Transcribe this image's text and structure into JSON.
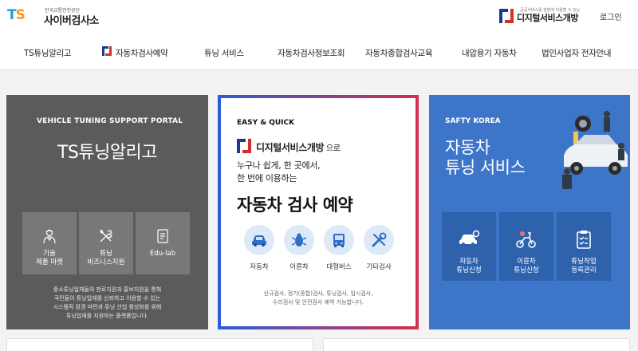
{
  "header": {
    "logo_mark_t": "T",
    "logo_mark_s": "S",
    "org_name": "한국교통안전공단",
    "site_title": "사이버검사소",
    "top_right_sub": "공공서비스를 한번에 이용할 수 있는",
    "digital_service": "디지털서비스개방",
    "login": "로그인"
  },
  "nav": {
    "items": [
      "TS튜닝알리고",
      "자동차검사예약",
      "튜닝 서비스",
      "자동차검사정보조회",
      "자동차종합검사교육",
      "내압용기 자동차",
      "법인사업자 전자안내"
    ]
  },
  "left_card": {
    "kicker": "VEHICLE TUNING SUPPORT PORTAL",
    "title": "TS튜닝알리고",
    "tiles": [
      {
        "label": "기술\n제품 마켓",
        "icon": "mechanic-icon"
      },
      {
        "label": "튜닝\n비즈니스지원",
        "icon": "tools-icon"
      },
      {
        "label": "Edu-lab",
        "icon": "document-icon"
      }
    ],
    "desc": "중소튜닝업체들의 판로지원과 홍보지원을 통해\n국민들이 튜닝업체를 신뢰하고 이용할 수 있는\n시스템적 환경 마련과 튜닝 산업 활성화를 위해\n튜닝업체를 지원하는 플랫폼입니다."
  },
  "mid_card": {
    "kicker": "EASY & QUICK",
    "brand": "디지털서비스개방",
    "brand_suffix": " 으로",
    "lines": "누구나 쉽게, 한 곳에서,\n한 번에 이용하는",
    "big": "자동차 검사 예약",
    "circles": [
      {
        "label": "자동차",
        "icon": "car-icon"
      },
      {
        "label": "이륜차",
        "icon": "bug-icon"
      },
      {
        "label": "대형버스",
        "icon": "bus-icon"
      },
      {
        "label": "기타검사",
        "icon": "wrench-icon"
      }
    ],
    "note": "신규검사, 정기(종합)검사, 튜닝검사, 임시검사,\n수리검사 및 안전검사 예약 가능합니다."
  },
  "right_card": {
    "kicker": "SAFTY KOREA",
    "title": "자동차\n튜닝 서비스",
    "tiles": [
      {
        "label": "자동차\n튜닝신청",
        "icon": "car-gear-icon"
      },
      {
        "label": "이륜차\n튜닝신청",
        "icon": "scooter-icon"
      },
      {
        "label": "튜닝작업\n등록관리",
        "icon": "clipboard-icon"
      }
    ]
  },
  "colors": {
    "left_bg": "#5b5b5b",
    "right_bg": "#3d76c9",
    "accent_blue": "#1e3a8a",
    "accent_red": "#d32f2f"
  }
}
